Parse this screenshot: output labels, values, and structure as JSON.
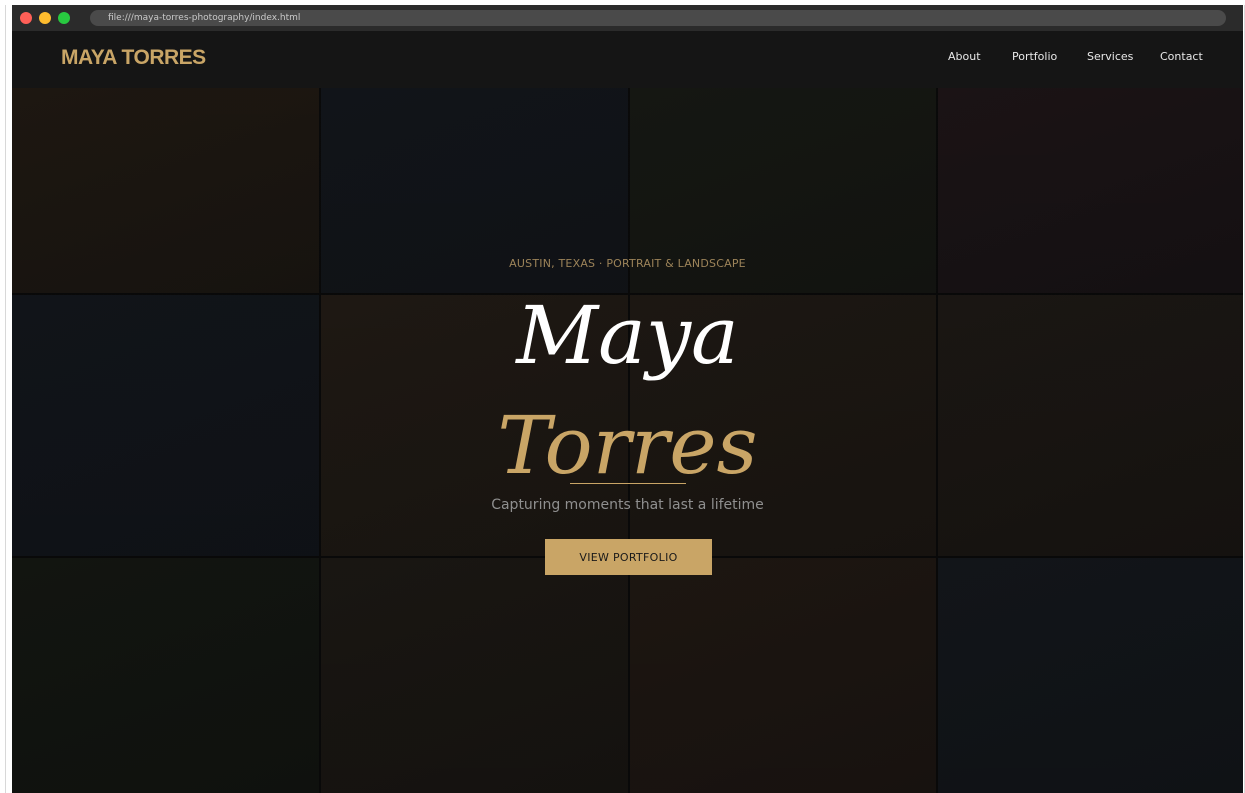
{
  "browser": {
    "url": "file:///maya-torres-photography/index.html"
  },
  "nav": {
    "logo": "MAYA TORRES",
    "links": [
      "About",
      "Portfolio",
      "Services",
      "Contact"
    ]
  },
  "hero": {
    "eyebrow": "AUSTIN, TEXAS  ·  PORTRAIT & LANDSCAPE",
    "name_first": "Maya",
    "name_last": "Torres",
    "tagline": "Capturing moments that last a lifetime",
    "cta_label": "VIEW PORTFOLIO"
  },
  "colors": {
    "accent": "#c9a566",
    "background": "#141414",
    "nav_text": "#e8e8e8"
  }
}
